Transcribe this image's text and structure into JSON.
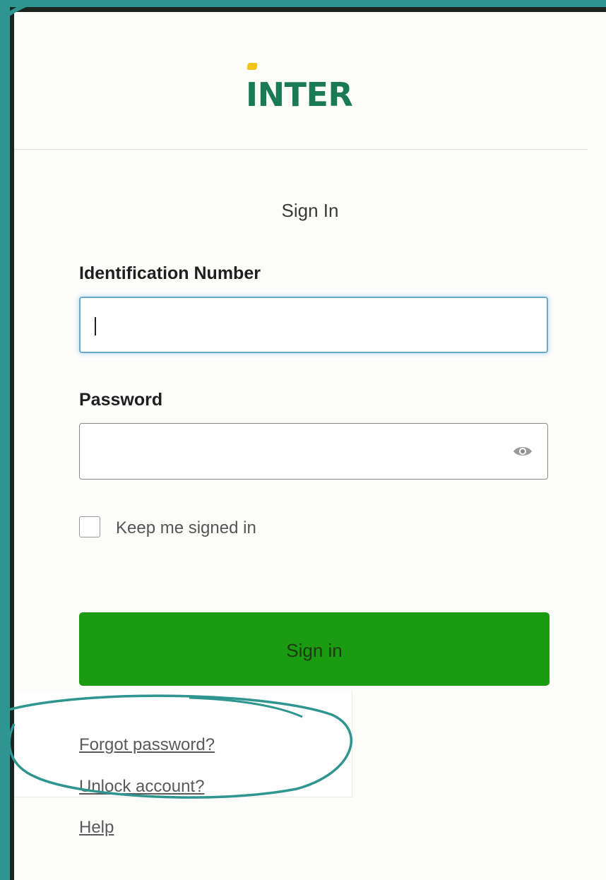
{
  "brand": {
    "logo_text": "INTER",
    "logo_accent_color": "#f2c318",
    "logo_color": "#1a7a55"
  },
  "form": {
    "title": "Sign In",
    "id_label": "Identification Number",
    "id_value": "",
    "password_label": "Password",
    "password_value": "",
    "password_toggle_icon": "eye-icon",
    "keep_signed_in_label": "Keep me signed in",
    "keep_signed_in_checked": false,
    "submit_label": "Sign in",
    "submit_color": "#1b9b12"
  },
  "links": [
    {
      "label": "Forgot password?"
    },
    {
      "label": "Unlock account?"
    },
    {
      "label": "Help"
    }
  ],
  "annotation": {
    "shape": "hand-drawn ellipse",
    "color": "#2e9590"
  }
}
